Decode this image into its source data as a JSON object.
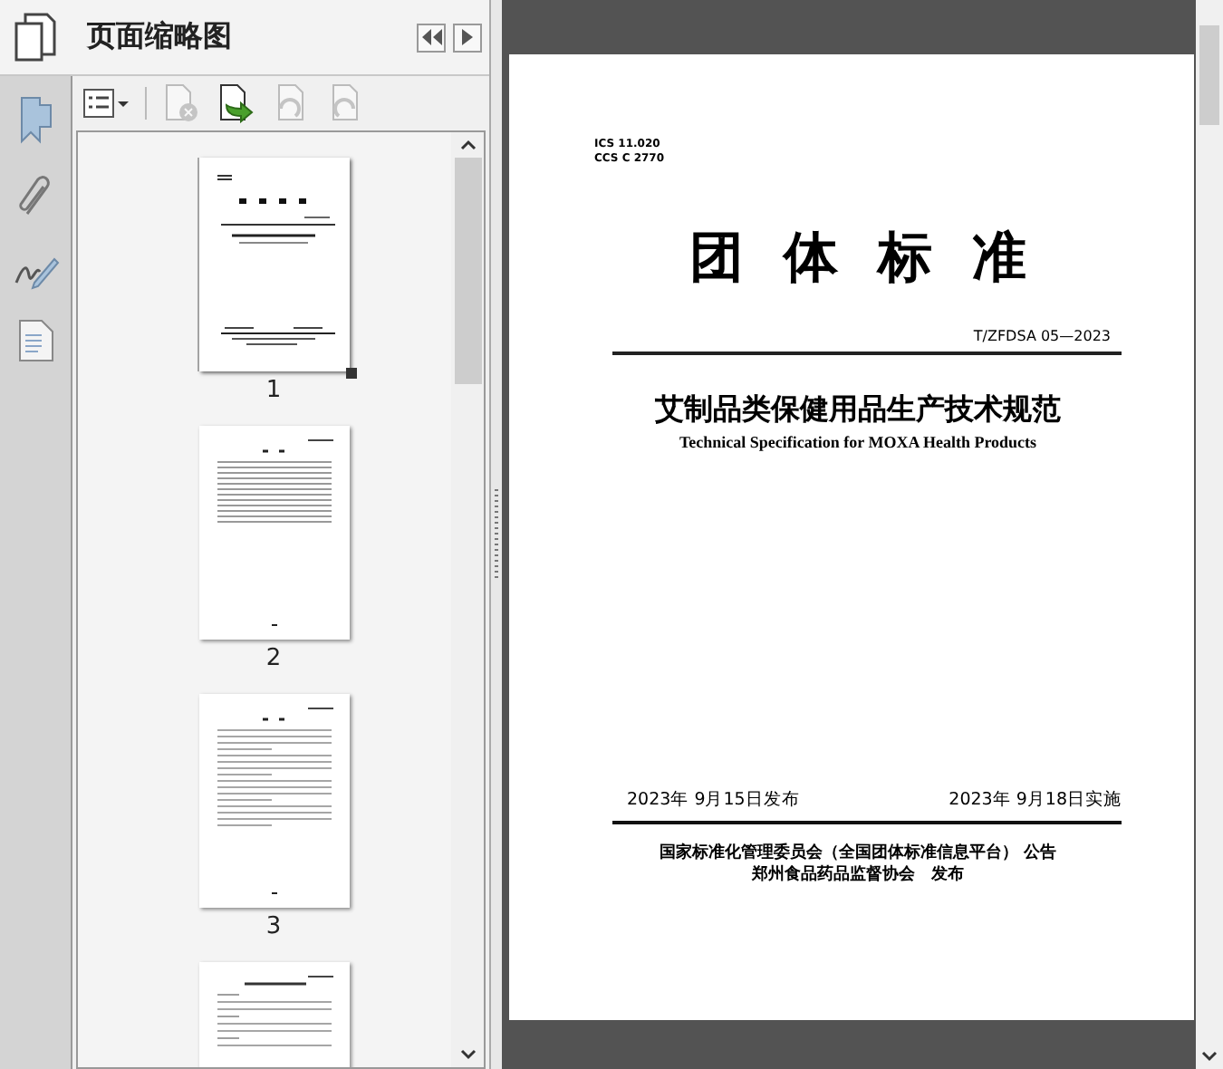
{
  "panel": {
    "title": "页面缩略图"
  },
  "toolbar": [
    {
      "kind": "options",
      "disabled": false
    },
    {
      "kind": "delete",
      "disabled": true
    },
    {
      "kind": "insert",
      "disabled": false
    },
    {
      "kind": "rotate-left",
      "disabled": true
    },
    {
      "kind": "rotate-right",
      "disabled": true
    }
  ],
  "thumbnails": [
    {
      "kind": "cover",
      "label": "1",
      "current": true
    },
    {
      "kind": "contents",
      "label": "2",
      "current": false
    },
    {
      "kind": "text",
      "label": "3",
      "current": false
    },
    {
      "kind": "body",
      "current": false
    }
  ],
  "document": {
    "ics": [
      "ICS 11.020",
      "CCS C 2770"
    ],
    "heading": "团体标准",
    "code": "T/ZFDSA 05—2023",
    "title_cn": "艾制品类保健用品生产技术规范",
    "title_en": "Technical Specification for MOXA Health Products",
    "issue_date": "2023年 9月15日发布",
    "implement_date": "2023年 9月18日实施",
    "publishers": [
      "国家标准化管理委员会（全国团体标准信息平台） 公告",
      "郑州食品药品监督协会　发布"
    ]
  }
}
